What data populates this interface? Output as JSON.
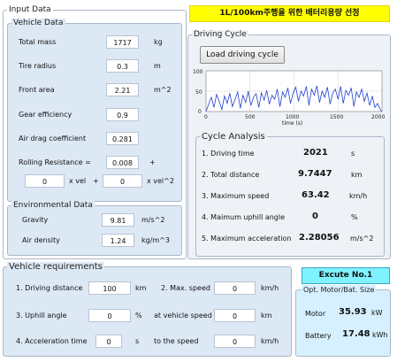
{
  "banner": {
    "title": "1L/100km주행을 위한 배터리용량 선정"
  },
  "input_data": {
    "legend": "Input Data",
    "vehicle": {
      "legend": "Vehicle Data",
      "total_mass": {
        "label": "Total mass",
        "value": "1717",
        "unit": "kg"
      },
      "tire_radius": {
        "label": "Tire radius",
        "value": "0.3",
        "unit": "m"
      },
      "front_area": {
        "label": "Front area",
        "value": "2.21",
        "unit": "m^2"
      },
      "gear_eff": {
        "label": "Gear efficiency",
        "value": "0.9",
        "unit": ""
      },
      "air_drag": {
        "label": "Air drag coefficient",
        "value": "0.281",
        "unit": ""
      },
      "rolling": {
        "label": "Rolling Resistance =",
        "value": "0.008",
        "plus": "+",
        "v1": "0",
        "t1": "x vel",
        "plus2": "+",
        "v2": "0",
        "t2": "x vel^2"
      }
    },
    "env": {
      "legend": "Environmental Data",
      "gravity": {
        "label": "Gravity",
        "value": "9.81",
        "unit": "m/s^2"
      },
      "air_density": {
        "label": "Air density",
        "value": "1.24",
        "unit": "kg/m^3"
      }
    }
  },
  "driving_cycle": {
    "legend": "Driving Cycle",
    "load_button": "Load driving cycle",
    "chart": {
      "y_ticks": [
        "100",
        "50",
        "0"
      ],
      "x_ticks": [
        "0",
        "500",
        "1000",
        "1500",
        "2000"
      ],
      "xlabel": "time (s)"
    }
  },
  "chart_data": {
    "type": "line",
    "xlabel": "time (s)",
    "ylabel": "",
    "xlim": [
      0,
      2000
    ],
    "ylim": [
      0,
      100
    ],
    "grid": true,
    "series": [
      {
        "color": "#1f3fd0",
        "x": [
          0,
          30,
          60,
          90,
          120,
          150,
          180,
          210,
          240,
          270,
          300,
          330,
          360,
          390,
          420,
          450,
          480,
          510,
          540,
          570,
          600,
          630,
          660,
          690,
          720,
          750,
          780,
          810,
          840,
          870,
          900,
          930,
          960,
          990,
          1020,
          1050,
          1080,
          1110,
          1140,
          1170,
          1200,
          1230,
          1260,
          1290,
          1320,
          1350,
          1380,
          1410,
          1440,
          1470,
          1500,
          1530,
          1560,
          1590,
          1620,
          1650,
          1680,
          1710,
          1740,
          1770,
          1800,
          1830,
          1860,
          1890,
          1920,
          1950,
          1980,
          2000
        ],
        "y": [
          0,
          18,
          35,
          10,
          42,
          25,
          5,
          38,
          20,
          45,
          12,
          30,
          48,
          8,
          40,
          22,
          50,
          15,
          35,
          44,
          10,
          46,
          28,
          52,
          18,
          40,
          30,
          55,
          12,
          48,
          35,
          58,
          20,
          45,
          60,
          25,
          50,
          38,
          62,
          15,
          55,
          40,
          63,
          22,
          50,
          35,
          60,
          18,
          45,
          55,
          30,
          62,
          20,
          52,
          40,
          58,
          12,
          48,
          35,
          55,
          25,
          45,
          15,
          38,
          10,
          20,
          5,
          0
        ]
      }
    ]
  },
  "cycle_analysis": {
    "legend": "Cycle Analysis",
    "rows": [
      {
        "label": "1. Driving time",
        "value": "2021",
        "unit": "s"
      },
      {
        "label": "2. Total distance",
        "value": "9.7447",
        "unit": "km"
      },
      {
        "label": "3. Maximum speed",
        "value": "63.42",
        "unit": "km/h"
      },
      {
        "label": "4. Maimum uphill angle",
        "value": "0",
        "unit": "%"
      },
      {
        "label": "5. Maximum acceleration",
        "value": "2.28056",
        "unit": "m/s^2"
      }
    ]
  },
  "vehicle_req": {
    "legend": "Vehicle requirements",
    "driving_distance": {
      "label": "1. Driving distance",
      "value": "100",
      "unit": "km"
    },
    "max_speed": {
      "label": "2. Max. speed",
      "value": "0",
      "unit": "km/h"
    },
    "uphill": {
      "label": "3. Uphill angle",
      "value": "0",
      "unit": "%"
    },
    "at_speed": {
      "label": "at vehicle speed",
      "value": "0",
      "unit": "km"
    },
    "accel_time": {
      "label": "4. Acceleration time",
      "value": "0",
      "unit": "s"
    },
    "to_speed": {
      "label": "to the speed",
      "value": "0",
      "unit": "km/h"
    }
  },
  "execute": {
    "button": "Excute No.1"
  },
  "opt_size": {
    "legend": "Opt. Motor/Bat. Size",
    "motor": {
      "label": "Motor",
      "value": "35.93",
      "unit": "kW"
    },
    "battery": {
      "label": "Battery",
      "value": "17.48",
      "unit": "kWh"
    }
  }
}
